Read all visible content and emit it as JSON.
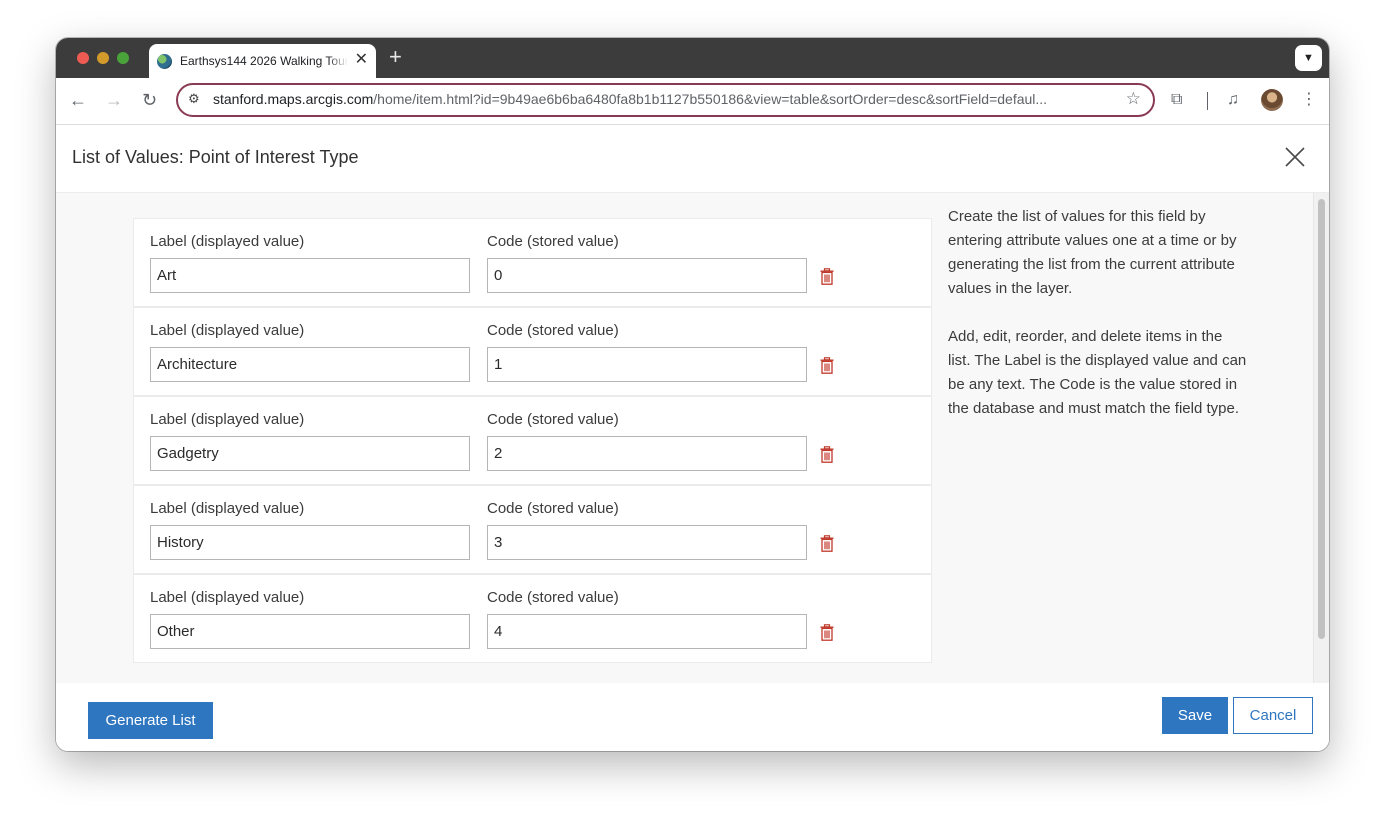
{
  "browser": {
    "tab_title": "Earthsys144 2026 Walking Tour",
    "new_tab_symbol": "+",
    "url_host": "stanford.maps.arcgis.com",
    "url_path": "/home/item.html?id=9b49ae6b6ba6480fa8b1b1127b550186&view=table&sortOrder=desc&sortField=defaul..."
  },
  "dialog": {
    "title": "List of Values: Point of Interest Type",
    "column_label_header": "Label (displayed value)",
    "column_code_header": "Code (stored value)",
    "rows": [
      {
        "label": "Art",
        "code": "0"
      },
      {
        "label": "Architecture",
        "code": "1"
      },
      {
        "label": "Gadgetry",
        "code": "2"
      },
      {
        "label": "History",
        "code": "3"
      },
      {
        "label": "Other",
        "code": "4"
      }
    ],
    "help_paragraph_1": "Create the list of values for this field by entering attribute values one at a time or by generating the list from the current attribute values in the layer.",
    "help_paragraph_2": "Add, edit, reorder, and delete items in the list. The Label is the displayed value and can be any text. The Code is the value stored in the database and must match the field type.",
    "generate_button": "Generate List",
    "save_button": "Save",
    "cancel_button": "Cancel"
  },
  "colors": {
    "primary_button": "#2f76c0",
    "delete_icon": "#c0392b",
    "omnibox_border": "#8a3b53"
  },
  "icons": [
    "back-arrow-icon",
    "forward-arrow-icon",
    "reload-icon",
    "site-info-icon",
    "bookmark-star-icon",
    "extensions-icon",
    "media-controls-icon",
    "menu-dots-icon",
    "close-icon",
    "trash-icon"
  ]
}
